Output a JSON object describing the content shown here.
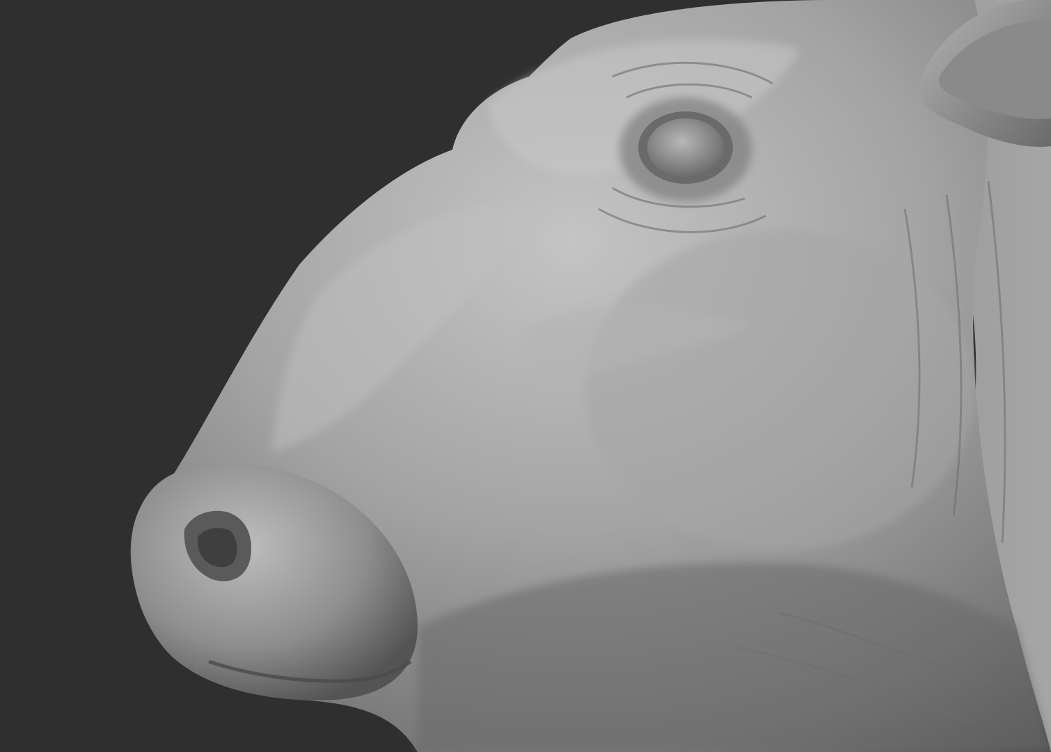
{
  "scene": {
    "subject": "cow-head-sculpt",
    "view": "left-profile",
    "colors": {
      "background": "#2f2f30",
      "clay_light": "#c9c9c9",
      "clay_mid": "#9e9e9e",
      "clay_dark": "#5a5a5a",
      "clay_shadow": "#3e3e3e"
    }
  }
}
